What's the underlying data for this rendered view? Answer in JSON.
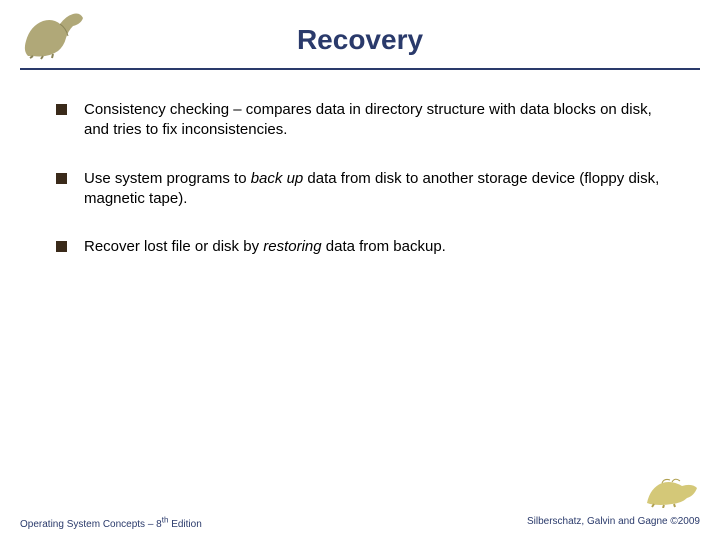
{
  "header": {
    "title": "Recovery"
  },
  "bullets": {
    "b1_pre": "Consistency checking – compares data in directory structure with data blocks on disk, and tries to fix inconsistencies.",
    "b2_pre": "Use system programs to ",
    "b2_em": "back up",
    "b2_post": " data from disk to another storage device (floppy disk, magnetic tape).",
    "b3_pre": "Recover lost file or disk by ",
    "b3_em": "restoring",
    "b3_post": " data from backup."
  },
  "footer": {
    "left_pre": "Operating System Concepts – 8",
    "left_sup": "th",
    "left_post": " Edition",
    "right": "Silberschatz, Galvin and Gagne ©2009"
  }
}
